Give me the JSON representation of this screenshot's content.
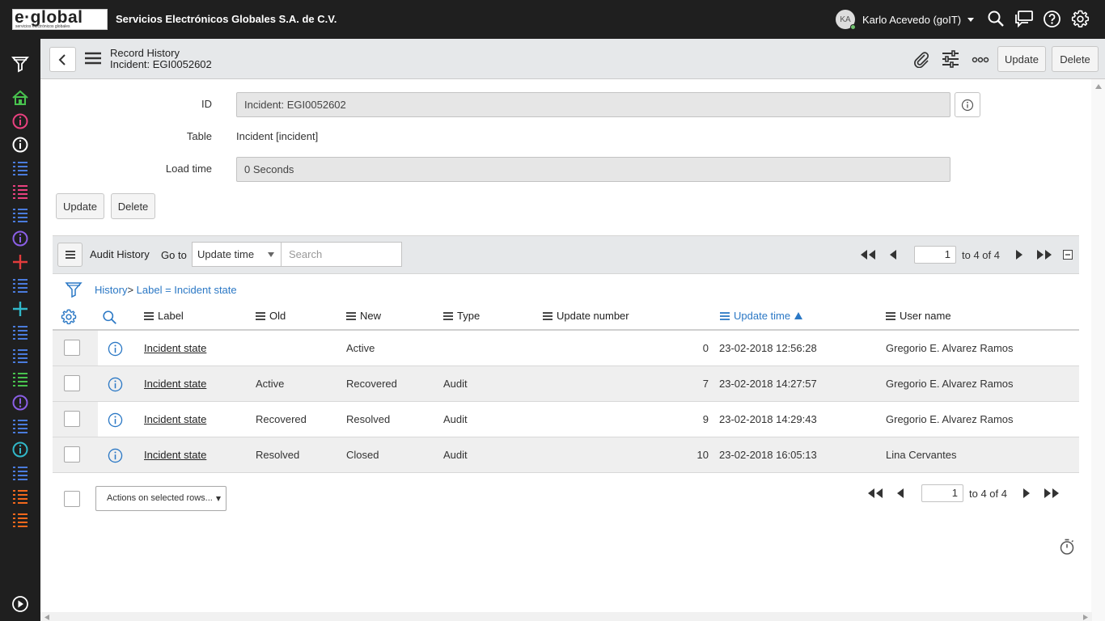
{
  "banner": {
    "logo_text": "e·global",
    "logo_subtext": "servicios electrónicos globales",
    "company": "Servicios Electrónicos Globales S.A. de C.V.",
    "user_initials": "KA",
    "user_name": "Karlo Acevedo (goIT)"
  },
  "header": {
    "title": "Record History",
    "subtitle": "Incident: EGI0052602",
    "update_label": "Update",
    "delete_label": "Delete"
  },
  "form": {
    "id_label": "ID",
    "id_value": "Incident: EGI0052602",
    "table_label": "Table",
    "table_value": "Incident [incident]",
    "load_label": "Load time",
    "load_value": "0 Seconds",
    "update_label": "Update",
    "delete_label": "Delete"
  },
  "list": {
    "title": "Audit History",
    "goto_label": "Go to",
    "goto_value": "Update time",
    "search_placeholder": "Search",
    "page": "1",
    "page_range": "to 4 of 4",
    "breadcrumb_root": "History",
    "breadcrumb_sep": ">",
    "breadcrumb_filter": "Label = Incident state",
    "columns": {
      "label": "Label",
      "old": "Old",
      "new": "New",
      "type": "Type",
      "update_number": "Update number",
      "update_time": "Update time",
      "user_name": "User name"
    },
    "rows": [
      {
        "label": "Incident state",
        "old": "",
        "new": "Active",
        "type": "",
        "update_number": "0",
        "update_time": "23-02-2018 12:56:28",
        "user_name": "Gregorio E. Alvarez Ramos"
      },
      {
        "label": "Incident state",
        "old": "Active",
        "new": "Recovered",
        "type": "Audit",
        "update_number": "7",
        "update_time": "23-02-2018 14:27:57",
        "user_name": "Gregorio E. Alvarez Ramos"
      },
      {
        "label": "Incident state",
        "old": "Recovered",
        "new": "Resolved",
        "type": "Audit",
        "update_number": "9",
        "update_time": "23-02-2018 14:29:43",
        "user_name": "Gregorio E. Alvarez Ramos"
      },
      {
        "label": "Incident state",
        "old": "Resolved",
        "new": "Closed",
        "type": "Audit",
        "update_number": "10",
        "update_time": "23-02-2018 16:05:13",
        "user_name": "Lina Cervantes"
      }
    ],
    "actions_label": "Actions on selected rows...",
    "footer_page": "1",
    "footer_page_range": "to 4 of 4"
  },
  "colors": {
    "banner_bg": "#1f1f1f",
    "link": "#2b78c5",
    "nav_icon_blue": "#4a7bdc",
    "nav_icon_pink": "#e9417f",
    "nav_icon_red": "#e23c3c",
    "nav_icon_green": "#48c24e",
    "nav_icon_teal": "#31b8c9",
    "nav_icon_orange": "#f2681c",
    "nav_icon_purple": "#8b5fe6"
  }
}
